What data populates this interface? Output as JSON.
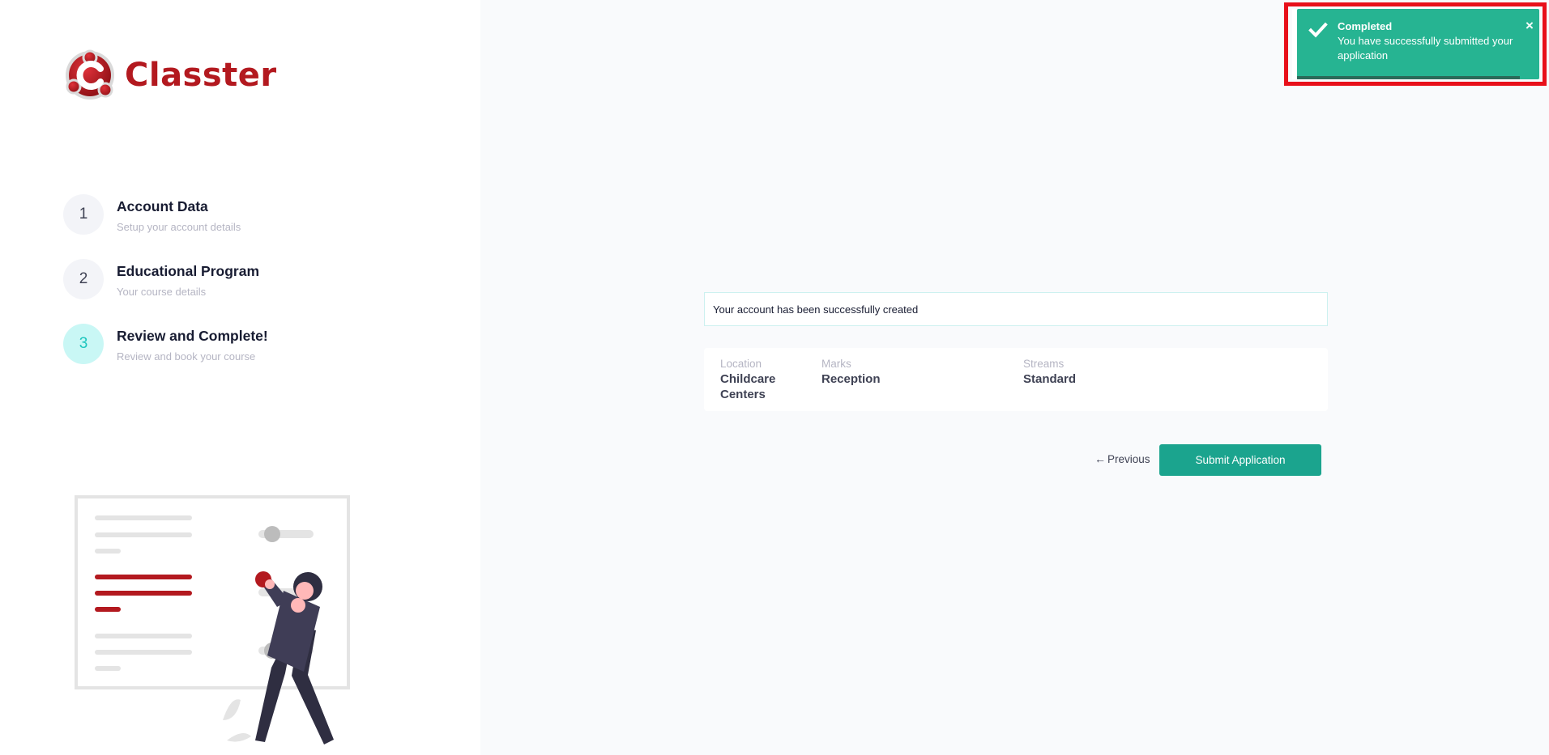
{
  "brand": {
    "name": "Classter",
    "color": "#b3191f"
  },
  "steps": [
    {
      "number": "1",
      "title": "Account Data",
      "desc": "Setup your account details",
      "active": false
    },
    {
      "number": "2",
      "title": "Educational Program",
      "desc": "Your course details",
      "active": false
    },
    {
      "number": "3",
      "title": "Review and Complete!",
      "desc": "Review and book your course",
      "active": true
    }
  ],
  "alert": {
    "text": "Your account has been successfully created"
  },
  "details": [
    {
      "label": "Location",
      "value": "Childcare Centers"
    },
    {
      "label": "Marks",
      "value": "Reception"
    },
    {
      "label": "Streams",
      "value": "Standard"
    }
  ],
  "actions": {
    "previous_label": "Previous",
    "previous_icon": "arrow-left-icon",
    "submit_label": "Submit Application"
  },
  "toast": {
    "title": "Completed",
    "message": "You have successfully submitted your application",
    "close": "×",
    "icon": "check-icon",
    "color": "#26b492",
    "progress_fraction": 0.92
  },
  "colors": {
    "accent": "#1ba48e",
    "active_step": "#1bc5bd",
    "highlight": "#e8101a"
  }
}
